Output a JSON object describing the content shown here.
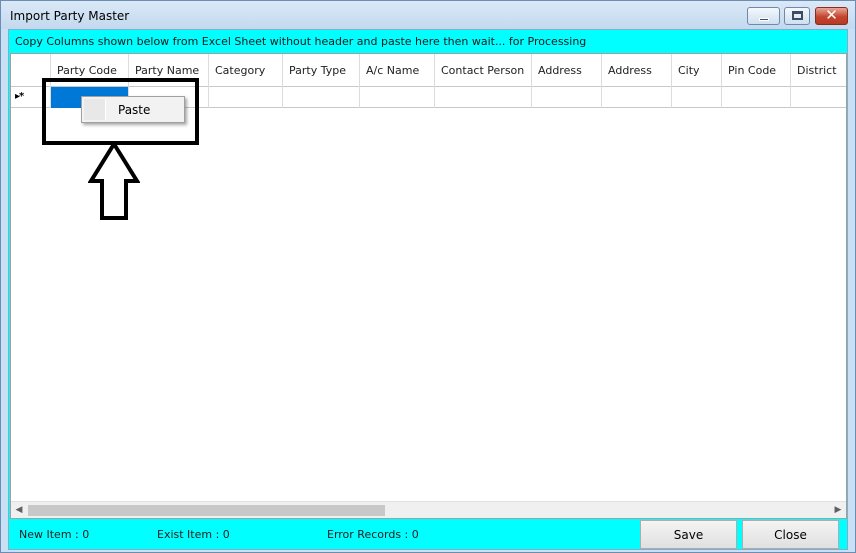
{
  "window": {
    "title": "Import Party Master"
  },
  "instruction": "Copy Columns shown below from Excel Sheet without header and paste here then wait... for Processing",
  "grid": {
    "columns": [
      "Party Code",
      "Party Name",
      "Category",
      "Party Type",
      "A/c Name",
      "Contact Person",
      "Address",
      "Address",
      "City",
      "Pin Code",
      "District"
    ],
    "new_row_indicator": "▸*"
  },
  "context_menu": {
    "items": [
      "Paste"
    ]
  },
  "status": {
    "new_item": "New Item :  0",
    "exist_item": "Exist Item :  0",
    "error_records": "Error Records :  0"
  },
  "buttons": {
    "save": "Save",
    "close": "Close"
  },
  "colors": {
    "panel": "#00ffff",
    "selection": "#0078d7",
    "close_button": "#c4452e"
  }
}
